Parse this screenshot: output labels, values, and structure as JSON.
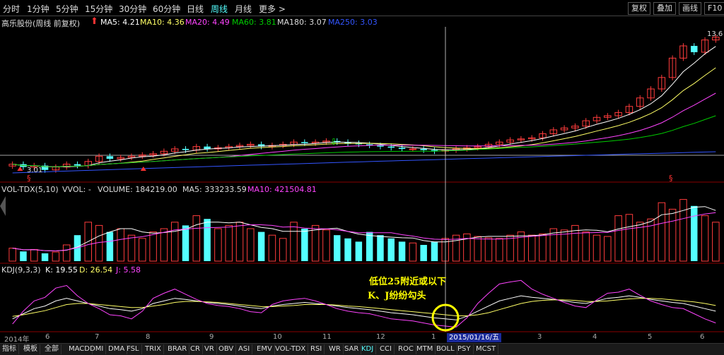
{
  "periods": [
    "分时",
    "1分钟",
    "5分钟",
    "15分钟",
    "30分钟",
    "60分钟",
    "日线",
    "周线",
    "月线",
    "更多 >"
  ],
  "active_period": 7,
  "toolbar_right": [
    "复权",
    "叠加",
    "画线",
    "F10"
  ],
  "main_info": {
    "name": "高乐股份(周线 前复权)",
    "ma5": "MA5: 4.21",
    "ma10": "MA10: 4.36",
    "ma20": "MA20: 4.49",
    "ma60": "MA60: 3.81",
    "ma180": "MA180: 3.07",
    "ma250": "MA250: 3.03"
  },
  "price_high_label": "13.6",
  "price_low_label": "3.01",
  "vol_info": {
    "name": "VOL-TDX(5,10)",
    "vvol": "VVOL: -",
    "volume": "VOLUME: 184219.00",
    "ma5": "MA5: 333233.59",
    "ma10": "MA10: 421504.81"
  },
  "kdj_info": {
    "name": "KDJ(9,3,3)",
    "k": "K: 19.55",
    "d": "D: 26.54",
    "j": "J: 5.58"
  },
  "annotation": {
    "line1": "低位25附近或以下",
    "line2": "K、J纷纷勾头"
  },
  "x_labels": [
    "2014年",
    "6",
    "7",
    "8",
    "9",
    "10",
    "11",
    "12",
    "1",
    "3",
    "4",
    "5",
    "6"
  ],
  "cursor_date": "2015/01/16/五",
  "bottom_tabs": [
    "指标",
    "模板",
    "全部",
    "MACD",
    "DMI",
    "DMA",
    "FSL",
    "TRIX",
    "BRAR",
    "CR",
    "VR",
    "OBV",
    "ASI",
    "EMV",
    "VOL-TDX",
    "RSI",
    "WR",
    "SAR",
    "KDJ",
    "CCI",
    "ROC",
    "MTM",
    "BOLL",
    "PSY",
    "MCST"
  ],
  "active_tab": "KDJ",
  "colors": {
    "up": "#ff3c3c",
    "down": "#54ffff",
    "ma5": "#ffffff",
    "ma10": "#ffff66",
    "ma20": "#ff44ff",
    "ma60": "#00cc00",
    "ma250": "#3355ff",
    "k": "#ffffff",
    "d": "#ffff66",
    "j": "#ff44ff"
  },
  "chart_data": {
    "type": "candlestick",
    "weeks": 66,
    "close": [
      3.3,
      3.2,
      3.25,
      3.1,
      3.2,
      3.3,
      3.25,
      3.4,
      3.6,
      3.5,
      3.55,
      3.6,
      3.65,
      3.7,
      3.8,
      3.9,
      3.85,
      4.0,
      3.9,
      3.95,
      4.0,
      4.05,
      4.1,
      4.0,
      4.05,
      4.1,
      4.2,
      4.15,
      4.2,
      4.25,
      4.2,
      4.15,
      4.1,
      4.05,
      4.0,
      3.95,
      3.9,
      3.9,
      3.85,
      3.8,
      3.85,
      3.9,
      3.95,
      4.0,
      4.1,
      4.2,
      4.3,
      4.35,
      4.4,
      4.6,
      4.8,
      4.9,
      5.0,
      5.3,
      5.5,
      5.6,
      5.8,
      6.2,
      6.8,
      7.5,
      8.5,
      10.5,
      12.0,
      11.2,
      12.8,
      13.2
    ],
    "volume": [
      20,
      15,
      18,
      12,
      14,
      25,
      40,
      60,
      55,
      45,
      50,
      40,
      35,
      45,
      50,
      60,
      55,
      70,
      65,
      50,
      55,
      60,
      50,
      45,
      40,
      35,
      60,
      50,
      55,
      48,
      40,
      35,
      30,
      45,
      40,
      35,
      30,
      28,
      25,
      30,
      35,
      40,
      42,
      38,
      36,
      35,
      40,
      45,
      40,
      42,
      50,
      48,
      55,
      45,
      40,
      38,
      70,
      72,
      60,
      65,
      90,
      80,
      95,
      85,
      70,
      60
    ],
    "kdj_k": [
      20,
      30,
      40,
      45,
      55,
      60,
      55,
      50,
      45,
      40,
      38,
      35,
      40,
      50,
      55,
      60,
      58,
      55,
      52,
      50,
      48,
      45,
      42,
      40,
      45,
      48,
      50,
      52,
      50,
      48,
      45,
      42,
      40,
      38,
      35,
      32,
      30,
      28,
      25,
      22,
      20,
      18,
      25,
      35,
      45,
      55,
      60,
      65,
      62,
      60,
      58,
      55,
      52,
      50,
      55,
      60,
      62,
      65,
      62,
      58,
      55,
      52,
      50,
      45,
      40,
      35
    ],
    "kdj_d": [
      25,
      28,
      32,
      36,
      42,
      48,
      50,
      50,
      48,
      46,
      44,
      42,
      42,
      45,
      48,
      52,
      54,
      54,
      53,
      52,
      50,
      48,
      46,
      44,
      44,
      45,
      46,
      48,
      48,
      48,
      47,
      45,
      44,
      42,
      40,
      38,
      36,
      34,
      32,
      30,
      28,
      26,
      26,
      28,
      32,
      38,
      44,
      50,
      54,
      56,
      57,
      57,
      56,
      54,
      54,
      55,
      57,
      59,
      60,
      60,
      59,
      57,
      55,
      53,
      50,
      46
    ],
    "kdj_j": [
      10,
      35,
      55,
      62,
      80,
      85,
      65,
      50,
      40,
      28,
      26,
      20,
      35,
      60,
      70,
      78,
      68,
      58,
      50,
      46,
      44,
      40,
      34,
      32,
      48,
      55,
      58,
      60,
      55,
      48,
      40,
      35,
      32,
      30,
      25,
      20,
      18,
      16,
      12,
      8,
      6,
      4,
      22,
      50,
      70,
      88,
      92,
      95,
      78,
      68,
      60,
      52,
      45,
      42,
      57,
      70,
      72,
      78,
      66,
      55,
      48,
      42,
      40,
      30,
      20,
      12
    ]
  }
}
